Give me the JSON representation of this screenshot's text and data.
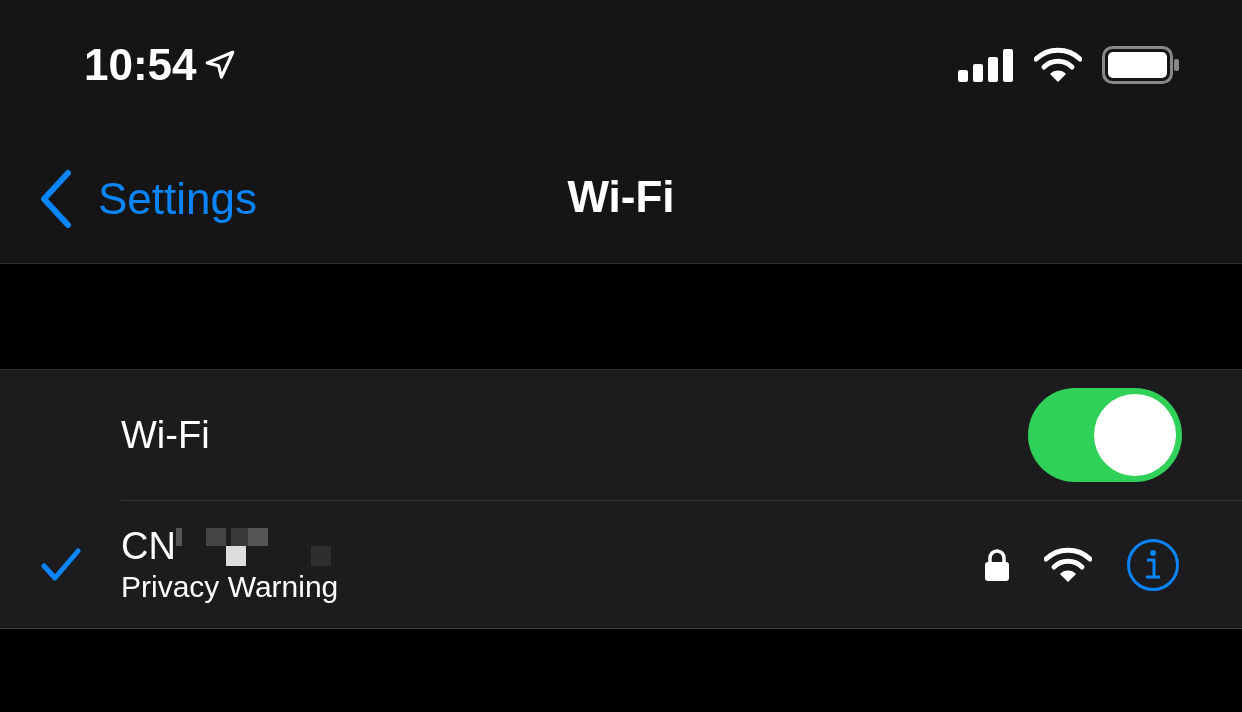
{
  "status_bar": {
    "time": "10:54",
    "location_active": true
  },
  "nav": {
    "back_label": "Settings",
    "title": "Wi-Fi"
  },
  "wifi_toggle": {
    "label": "Wi-Fi",
    "on": true
  },
  "networks": [
    {
      "name": "CN",
      "subtitle": "Privacy Warning",
      "selected": true,
      "secured": true
    }
  ]
}
